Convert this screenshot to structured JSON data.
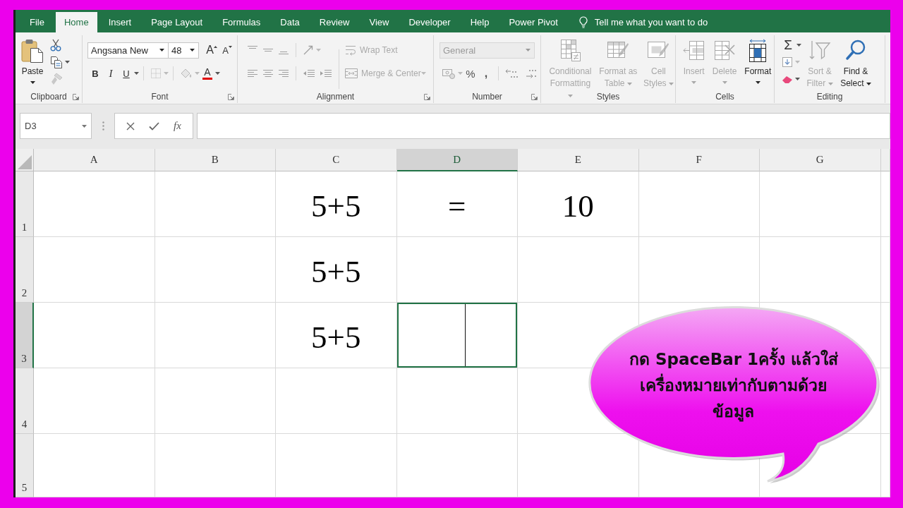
{
  "tabs": [
    {
      "label": "File",
      "selected": false
    },
    {
      "label": "Home",
      "selected": true
    },
    {
      "label": "Insert",
      "selected": false
    },
    {
      "label": "Page Layout",
      "selected": false
    },
    {
      "label": "Formulas",
      "selected": false
    },
    {
      "label": "Data",
      "selected": false
    },
    {
      "label": "Review",
      "selected": false
    },
    {
      "label": "View",
      "selected": false
    },
    {
      "label": "Developer",
      "selected": false
    },
    {
      "label": "Help",
      "selected": false
    },
    {
      "label": "Power Pivot",
      "selected": false
    }
  ],
  "tell_me": {
    "placeholder": "Tell me what you want to do"
  },
  "ribbon": {
    "groups": [
      {
        "label": "Clipboard",
        "launcher": true,
        "controls": [
          {
            "label": "Paste",
            "disabled": false
          }
        ]
      },
      {
        "label": "Font",
        "launcher": true,
        "font_name": "Angsana New",
        "font_size": "48",
        "glyphs": [
          "A",
          "A",
          "B",
          "I",
          "U",
          "A"
        ]
      },
      {
        "label": "Alignment",
        "launcher": true,
        "controls": [
          {
            "label": "Wrap Text",
            "disabled": true
          },
          {
            "label": "Merge & Center",
            "disabled": true
          }
        ]
      },
      {
        "label": "Number",
        "launcher": true,
        "number_format": {
          "value": "General",
          "disabled": true
        },
        "glyphs": [
          "%",
          ","
        ]
      },
      {
        "label": "Styles",
        "launcher": false,
        "controls": [
          {
            "label": "Conditional Formatting",
            "disabled": true
          },
          {
            "label": "Format as Table",
            "disabled": true
          },
          {
            "label": "Cell Styles",
            "disabled": true
          }
        ]
      },
      {
        "label": "Cells",
        "launcher": false,
        "controls": [
          {
            "label": "Insert",
            "disabled": true
          },
          {
            "label": "Delete",
            "disabled": true
          },
          {
            "label": "Format",
            "disabled": false
          }
        ]
      },
      {
        "label": "Editing",
        "launcher": false,
        "glyphs": [
          "Σ"
        ],
        "controls": [
          {
            "label": "Sort & Filter",
            "disabled": true
          },
          {
            "label": "Find & Select",
            "disabled": false
          }
        ]
      }
    ]
  },
  "name_box": {
    "value": "D3"
  },
  "formula_bar": {
    "function_glyph": "fx"
  },
  "columns": [
    {
      "label": "A",
      "selected": false
    },
    {
      "label": "B",
      "selected": false
    },
    {
      "label": "C",
      "selected": false
    },
    {
      "label": "D",
      "selected": true
    },
    {
      "label": "E",
      "selected": false
    },
    {
      "label": "F",
      "selected": false
    },
    {
      "label": "G",
      "selected": false
    }
  ],
  "rows": [
    {
      "label": "1",
      "selected": false,
      "cells": [
        {
          "selected": false
        },
        {
          "selected": false
        },
        {
          "value": "5+5",
          "selected": false
        },
        {
          "value": "=",
          "selected": false
        },
        {
          "value": "10",
          "selected": false
        },
        {
          "selected": false
        },
        {
          "selected": false
        }
      ]
    },
    {
      "label": "2",
      "selected": false,
      "cells": [
        {
          "selected": false
        },
        {
          "selected": false
        },
        {
          "value": "5+5",
          "selected": false
        },
        {
          "selected": false
        },
        {
          "selected": false
        },
        {
          "selected": false
        },
        {
          "selected": false
        }
      ]
    },
    {
      "label": "3",
      "selected": true,
      "cells": [
        {
          "selected": false
        },
        {
          "selected": false
        },
        {
          "value": "5+5",
          "selected": false
        },
        {
          "selected": true
        },
        {
          "selected": false
        },
        {
          "selected": false
        },
        {
          "selected": false
        }
      ]
    },
    {
      "label": "4",
      "selected": false,
      "cells": [
        {
          "selected": false
        },
        {
          "selected": false
        },
        {
          "selected": false
        },
        {
          "selected": false
        },
        {
          "selected": false
        },
        null,
        null
      ]
    },
    {
      "label": "5",
      "selected": false,
      "cells": [
        {
          "selected": false
        },
        {
          "selected": false
        },
        {
          "selected": false
        },
        {
          "selected": false
        },
        {
          "selected": false
        },
        {
          "selected": false
        },
        {
          "selected": false
        }
      ]
    }
  ],
  "edit_mode": true,
  "callout": {
    "text": "กด SpaceBar 1ครั้ง แล้วใส่\nเครื่องหมายเท่ากับตามด้วย\nข้อมูล"
  }
}
